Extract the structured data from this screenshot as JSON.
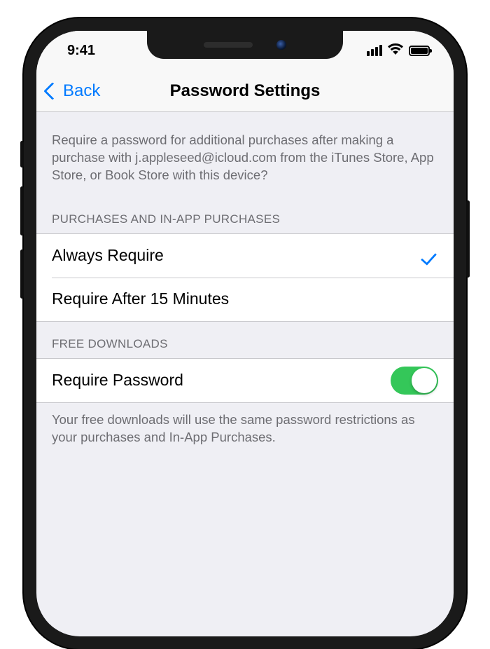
{
  "status": {
    "time": "9:41"
  },
  "nav": {
    "back": "Back",
    "title": "Password Settings"
  },
  "intro": "Require a password for additional purchases after making a purchase with j.appleseed@icloud.com from the iTunes Store, App Store, or Book Store with this device?",
  "sections": {
    "purchases": {
      "header": "PURCHASES AND IN-APP PURCHASES",
      "options": [
        {
          "label": "Always Require",
          "selected": true
        },
        {
          "label": "Require After 15 Minutes",
          "selected": false
        }
      ]
    },
    "free": {
      "header": "FREE DOWNLOADS",
      "toggle": {
        "label": "Require Password",
        "value": true
      },
      "footer": "Your free downloads will use the same password restrictions as your purchases and In-App Purchases."
    }
  }
}
